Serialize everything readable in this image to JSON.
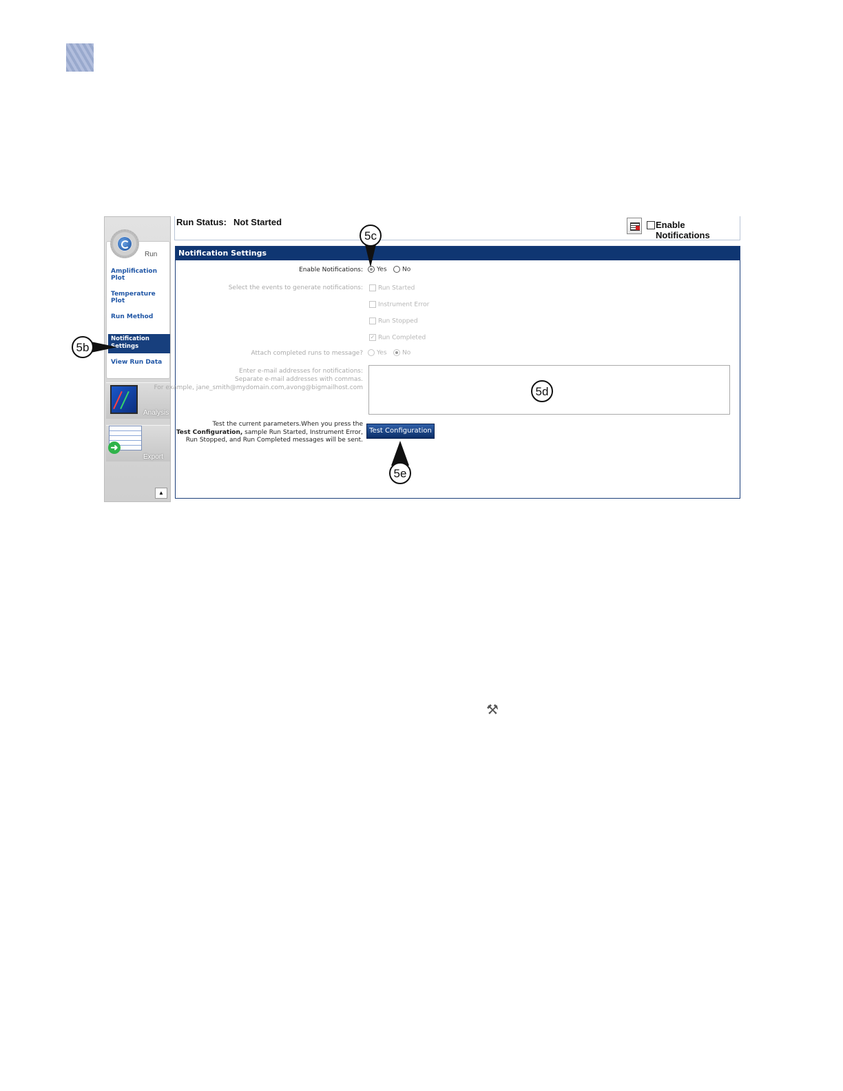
{
  "sidebar": {
    "run_label": "Run",
    "items": [
      {
        "label": "Amplification Plot"
      },
      {
        "label": "Temperature Plot"
      },
      {
        "label": "Run Method"
      },
      {
        "label": "Notification Settings"
      },
      {
        "label": "View Run Data"
      }
    ],
    "analysis_label": "Analysis",
    "export_label": "Export",
    "scroll_up": "▲"
  },
  "header": {
    "run_status_label": "Run Status:",
    "run_status_value": "Not Started",
    "enable_notifications_label": "Enable Notifications"
  },
  "panel": {
    "title": "Notification Settings",
    "enable_label": "Enable Notifications:",
    "yes": "Yes",
    "no": "No",
    "events_label": "Select the events to generate notifications:",
    "events": [
      "Run Started",
      "Instrument Error",
      "Run Stopped",
      "Run Completed"
    ],
    "attach_label": "Attach completed runs to message?",
    "email_label_1": "Enter e-mail addresses for notifications:",
    "email_label_2": "Separate e-mail addresses with commas.",
    "email_label_3": "For example, jane_smith@mydomain.com,avong@bigmailhost.com",
    "test_line_1": "Test the current parameters.When you press the",
    "test_line_2_bold": "Test Configuration,",
    "test_line_2_rest": " sample Run Started, Instrument Error,",
    "test_line_3": "Run Stopped, and Run Completed messages will be sent.",
    "test_button": "Test Configuration"
  },
  "callouts": {
    "c5b": "5b",
    "c5c": "5c",
    "c5d": "5d",
    "c5e": "5e"
  },
  "icons": [
    "settings-gear-icon",
    "notification-report-icon",
    "analysis-chart-icon",
    "export-table-icon",
    "tools-icon"
  ]
}
